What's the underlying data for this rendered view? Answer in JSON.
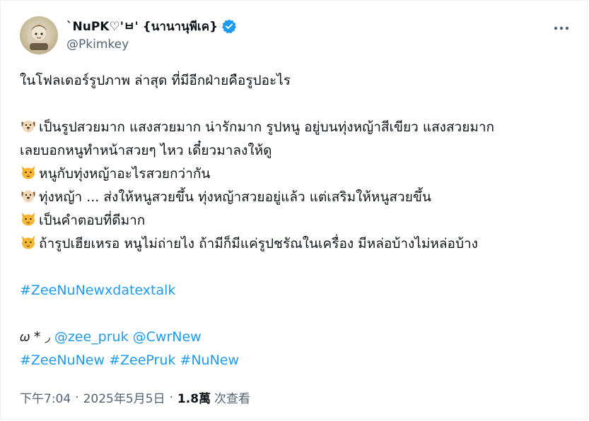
{
  "user": {
    "display_name": "`NuPK♡'ㅂ' {นานานุพีเค}",
    "handle": "@Pkimkey"
  },
  "tweet": {
    "intro": "ในโฟลเดอร์รูปภาพ ล่าสุด ที่มีอีกฝ่ายคือรูปอะไร",
    "lines": [
      {
        "icon": "dog-face-icon",
        "text": "เป็นรูปสวยมาก แสงสวยมาก น่ารักมาก รูปหนู อยู่บนทุ่งหญ้าสีเขียว แสงสวยมาก"
      },
      {
        "icon": "",
        "text": "เลยบอกหนูทำหน้าสวยๆ ไหว เดี๋ยวมาลงให้ดู"
      },
      {
        "icon": "cat-face-icon",
        "text": "หนูกับทุ่งหญ้าอะไรสวยกว่ากัน"
      },
      {
        "icon": "dog-face-icon",
        "text": "ทุ่งหญ้า ... ส่งให้หนูสวยขึ้น ทุ่งหญ้าสวยอยู่แล้ว แต่เสริมให้หนูสวยขึ้น"
      },
      {
        "icon": "cat-face-icon",
        "text": "เป็นคำตอบที่ดีมาก"
      },
      {
        "icon": "cat-face-icon",
        "text": "ถ้ารูปเฮียเหรอ หนูไม่ถ่ายไง ถ้ามีก็มีแค่รูปชรัณในเครื่อง มีหล่อบ้างไม่หล่อบ้าง"
      }
    ],
    "hashtag_main": "#ZeeNuNewxdatextalk",
    "mention_prefix": "𝜔 * ◞",
    "mentions": [
      "@zee_pruk",
      "@CwrNew"
    ],
    "hashtags": [
      "#ZeeNuNew",
      "#ZeePruk",
      "#NuNew"
    ]
  },
  "meta": {
    "time": "下午7:04",
    "separator": "·",
    "date": "2025年5月5日",
    "views_count": "1.8萬",
    "views_label": "次查看"
  },
  "colors": {
    "link": "#1d9bf0",
    "text": "#0f1419",
    "secondary": "#536471",
    "verified": "#1d9bf0"
  }
}
